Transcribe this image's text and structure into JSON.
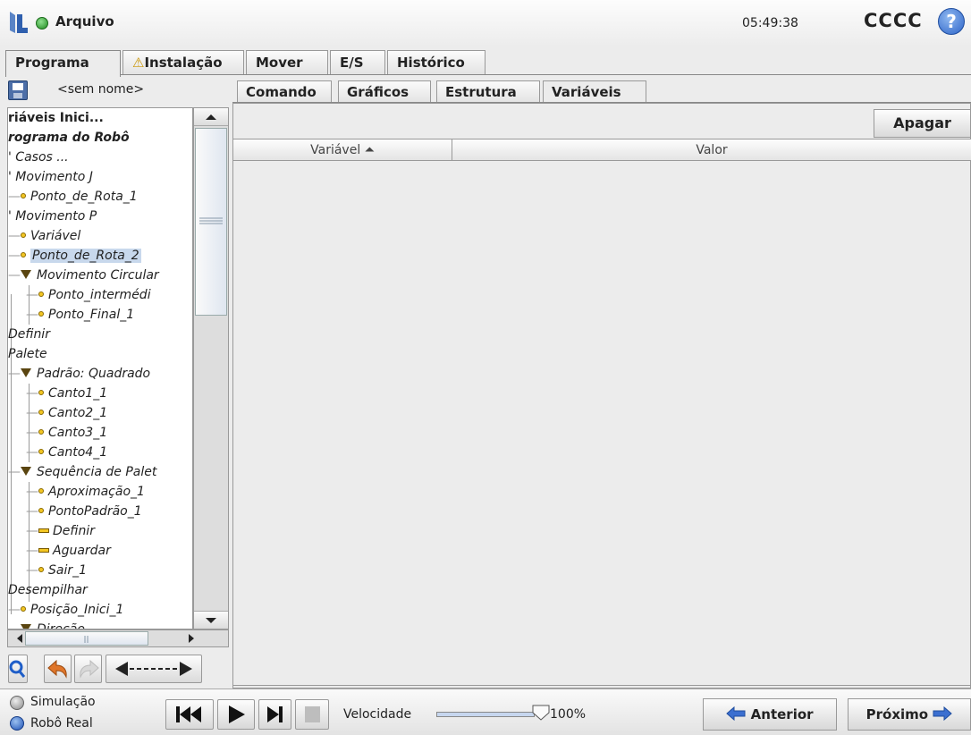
{
  "header": {
    "app_title": "Arquivo",
    "clock": "05:49:38",
    "robot_name": "CCCC",
    "help_symbol": "?"
  },
  "main_tabs": [
    {
      "label": "Programa",
      "active": true
    },
    {
      "label": "Instalação",
      "warning": true
    },
    {
      "label": "Mover"
    },
    {
      "label": "E/S"
    },
    {
      "label": "Histórico"
    }
  ],
  "program": {
    "file_name": "<sem nome>",
    "tree": [
      {
        "label": "riáveis Inici...",
        "bold": true,
        "italic": false
      },
      {
        "label": "rograma do Robô",
        "bold": true
      },
      {
        "label": "' Casos ..."
      },
      {
        "label": "' Movimento J"
      },
      {
        "label": "Ponto_de_Rota_1",
        "icon": "waypoint"
      },
      {
        "label": "' Movimento P"
      },
      {
        "label": "Variável",
        "icon": "waypoint"
      },
      {
        "label": "Ponto_de_Rota_2",
        "icon": "waypoint",
        "selected": true
      },
      {
        "label": "Movimento Circular",
        "icon": "expand"
      },
      {
        "label": "Ponto_intermédi",
        "icon": "waypoint"
      },
      {
        "label": "Ponto_Final_1",
        "icon": "waypoint"
      },
      {
        "label": "Definir"
      },
      {
        "label": "Palete"
      },
      {
        "label": "Padrão: Quadrado",
        "icon": "expand"
      },
      {
        "label": "Canto1_1",
        "icon": "waypoint"
      },
      {
        "label": "Canto2_1",
        "icon": "waypoint"
      },
      {
        "label": "Canto3_1",
        "icon": "waypoint"
      },
      {
        "label": "Canto4_1",
        "icon": "waypoint"
      },
      {
        "label": "Sequência de Palet",
        "icon": "expand"
      },
      {
        "label": "Aproximação_1",
        "icon": "waypoint"
      },
      {
        "label": "PontoPadrão_1",
        "icon": "waypoint"
      },
      {
        "label": "Definir",
        "icon": "set"
      },
      {
        "label": "Aguardar",
        "icon": "set"
      },
      {
        "label": "Sair_1",
        "icon": "waypoint"
      },
      {
        "label": "Desempilhar"
      },
      {
        "label": "Posição_Inici_1",
        "icon": "waypoint"
      },
      {
        "label": "Direção",
        "icon": "expand"
      }
    ]
  },
  "sub_tabs": [
    {
      "label": "Comando"
    },
    {
      "label": "Gráficos"
    },
    {
      "label": "Estrutura"
    },
    {
      "label": "Variáveis",
      "active": true
    }
  ],
  "variables": {
    "delete_label": "Apagar",
    "columns": [
      "Variável ⏶",
      "Valor"
    ],
    "rows": []
  },
  "footer": {
    "simulation_label": "Simulação",
    "real_robot_label": "Robô Real",
    "speed_label": "Velocidade",
    "speed_value": "100%",
    "speed_fraction": 1.0,
    "previous_label": "Anterior",
    "next_label": "Próximo"
  },
  "colors": {
    "accent_blue": "#2d64c8",
    "status_green": "#1f8a1f",
    "waypoint_yellow": "#f3c623",
    "selection": "#c8d8ec"
  }
}
